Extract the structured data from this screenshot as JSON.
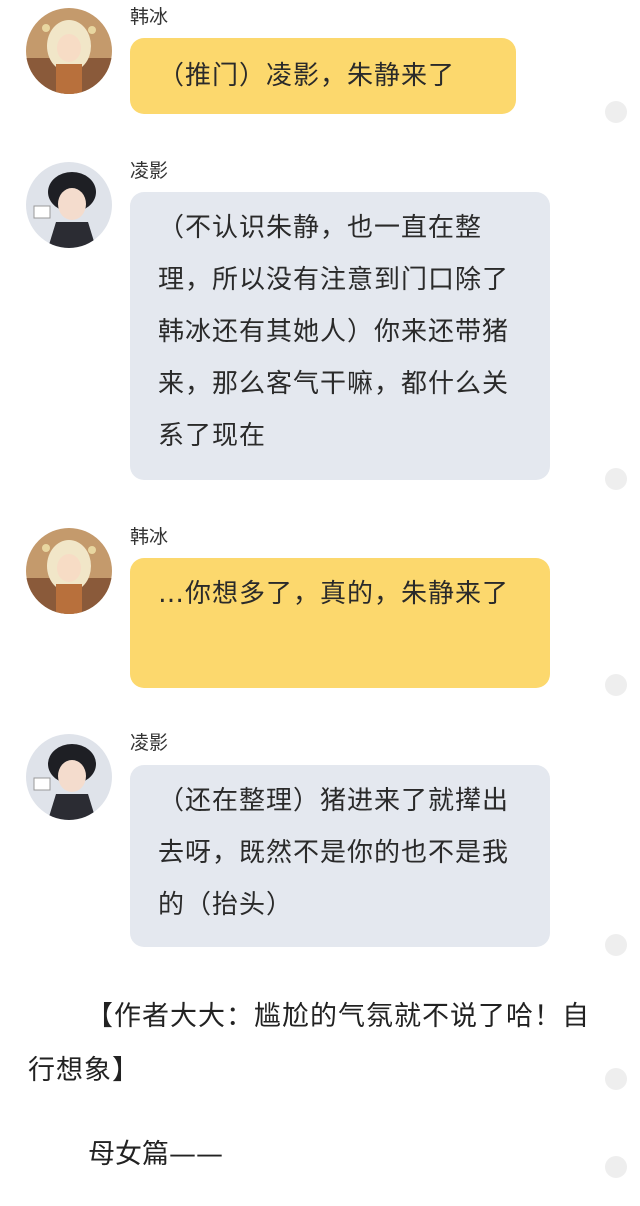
{
  "messages": [
    {
      "sender": "韩冰",
      "text": "（推门）凌影，朱静来了",
      "style": "yellow",
      "avatar": "blonde-girl-avatar"
    },
    {
      "sender": "凌影",
      "text": "（不认识朱静，也一直在整理，所以没有注意到门口除了韩冰还有其她人）你来还带猪来，那么客气干嘛，都什么关系了现在",
      "style": "grey",
      "avatar": "dark-hair-boy-avatar"
    },
    {
      "sender": "韩冰",
      "text": "…你想多了，真的，朱静来了",
      "style": "yellow",
      "avatar": "blonde-girl-avatar"
    },
    {
      "sender": "凌影",
      "text": "（还在整理）猪进来了就撵出去呀，既然不是你的也不是我的（抬头）",
      "style": "grey",
      "avatar": "dark-hair-boy-avatar"
    }
  ],
  "author_note": "【作者大大：尴尬的气氛就不说了哈！自行想象】",
  "chapter_title": "母女篇——",
  "colors": {
    "yellow_bubble": "#fcd86d",
    "grey_bubble": "#e4e8ef"
  }
}
